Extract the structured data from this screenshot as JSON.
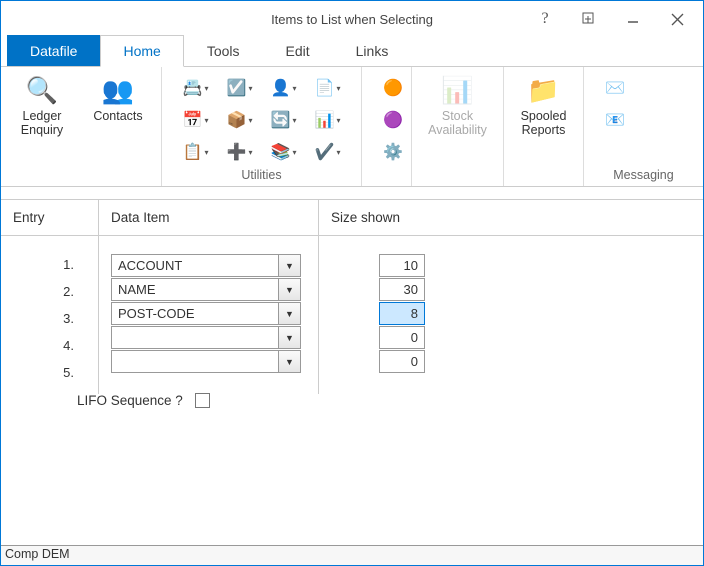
{
  "window": {
    "title": "Items to List when Selecting"
  },
  "tabs": {
    "file": "Datafile",
    "home": "Home",
    "tools": "Tools",
    "edit": "Edit",
    "links": "Links"
  },
  "ribbon": {
    "ledger": "Ledger\nEnquiry",
    "contacts": "Contacts",
    "utilities_label": "Utilities",
    "stock": "Stock\nAvailability",
    "spooled": "Spooled\nReports",
    "messaging_label": "Messaging"
  },
  "headers": {
    "entry": "Entry",
    "data_item": "Data Item",
    "size": "Size shown"
  },
  "rows": [
    {
      "num": "1.",
      "item": "ACCOUNT",
      "size": "10"
    },
    {
      "num": "2.",
      "item": "NAME",
      "size": "30"
    },
    {
      "num": "3.",
      "item": "POST-CODE",
      "size": "8",
      "active": true
    },
    {
      "num": "4.",
      "item": "",
      "size": "0"
    },
    {
      "num": "5.",
      "item": "",
      "size": "0"
    }
  ],
  "lifo_label": "LIFO Sequence ?",
  "status": "Comp DEM"
}
